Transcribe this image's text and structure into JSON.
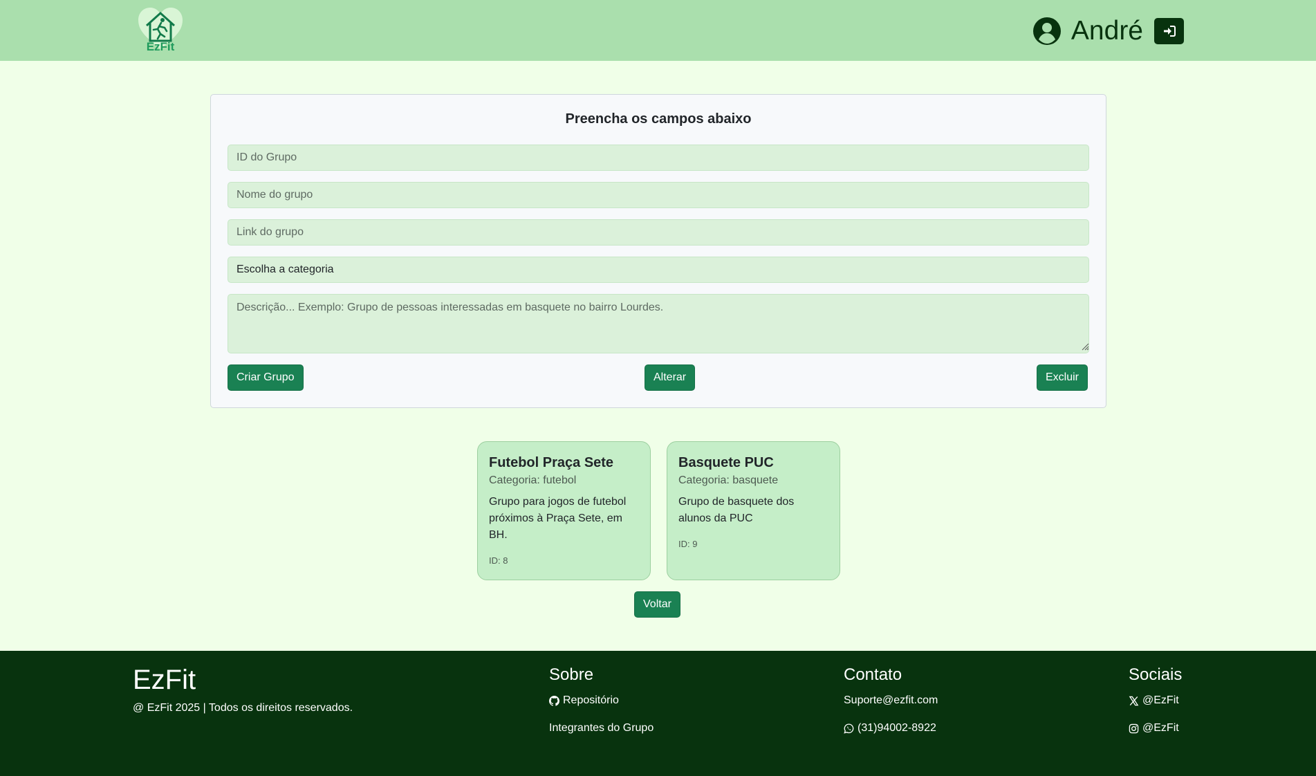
{
  "header": {
    "brand": "EzFit",
    "user_name": "André"
  },
  "form": {
    "title": "Preencha os campos abaixo",
    "id_placeholder": "ID do Grupo",
    "name_placeholder": "Nome do grupo",
    "link_placeholder": "Link do grupo",
    "category_selected": "Escolha a categoria",
    "description_placeholder": "Descrição... Exemplo: Grupo de pessoas interessadas em basquete no bairro Lourdes.",
    "create_label": "Criar Grupo",
    "update_label": "Alterar",
    "delete_label": "Excluir"
  },
  "groups": [
    {
      "title": "Futebol Praça Sete",
      "category": "Categoria: futebol",
      "description": "Grupo para jogos de futebol próximos à Praça Sete, em BH.",
      "id": "ID: 8"
    },
    {
      "title": "Basquete PUC",
      "category": "Categoria: basquete",
      "description": "Grupo de basquete dos alunos da PUC",
      "id": "ID: 9"
    }
  ],
  "back_label": "Voltar",
  "footer": {
    "brand": "EzFit",
    "copyright": "@ EzFit 2025 | Todos os direitos reservados.",
    "about": {
      "heading": "Sobre",
      "repo": "Repositório",
      "members": "Integrantes do Grupo"
    },
    "contact": {
      "heading": "Contato",
      "email": "Suporte@ezfit.com",
      "phone": "(31)94002-8922"
    },
    "social": {
      "heading": "Sociais",
      "x": "@EzFit",
      "instagram": "@EzFit"
    }
  },
  "colors": {
    "header_bg": "#aadfad",
    "page_bg": "#f0ffe8",
    "accent": "#1a8153",
    "dark": "#08330e",
    "card_bg": "#c5eec8"
  },
  "icons": [
    "house-runner-logo",
    "user-circle-icon",
    "sign-in-icon",
    "github-icon",
    "whatsapp-icon",
    "x-icon",
    "instagram-icon"
  ]
}
